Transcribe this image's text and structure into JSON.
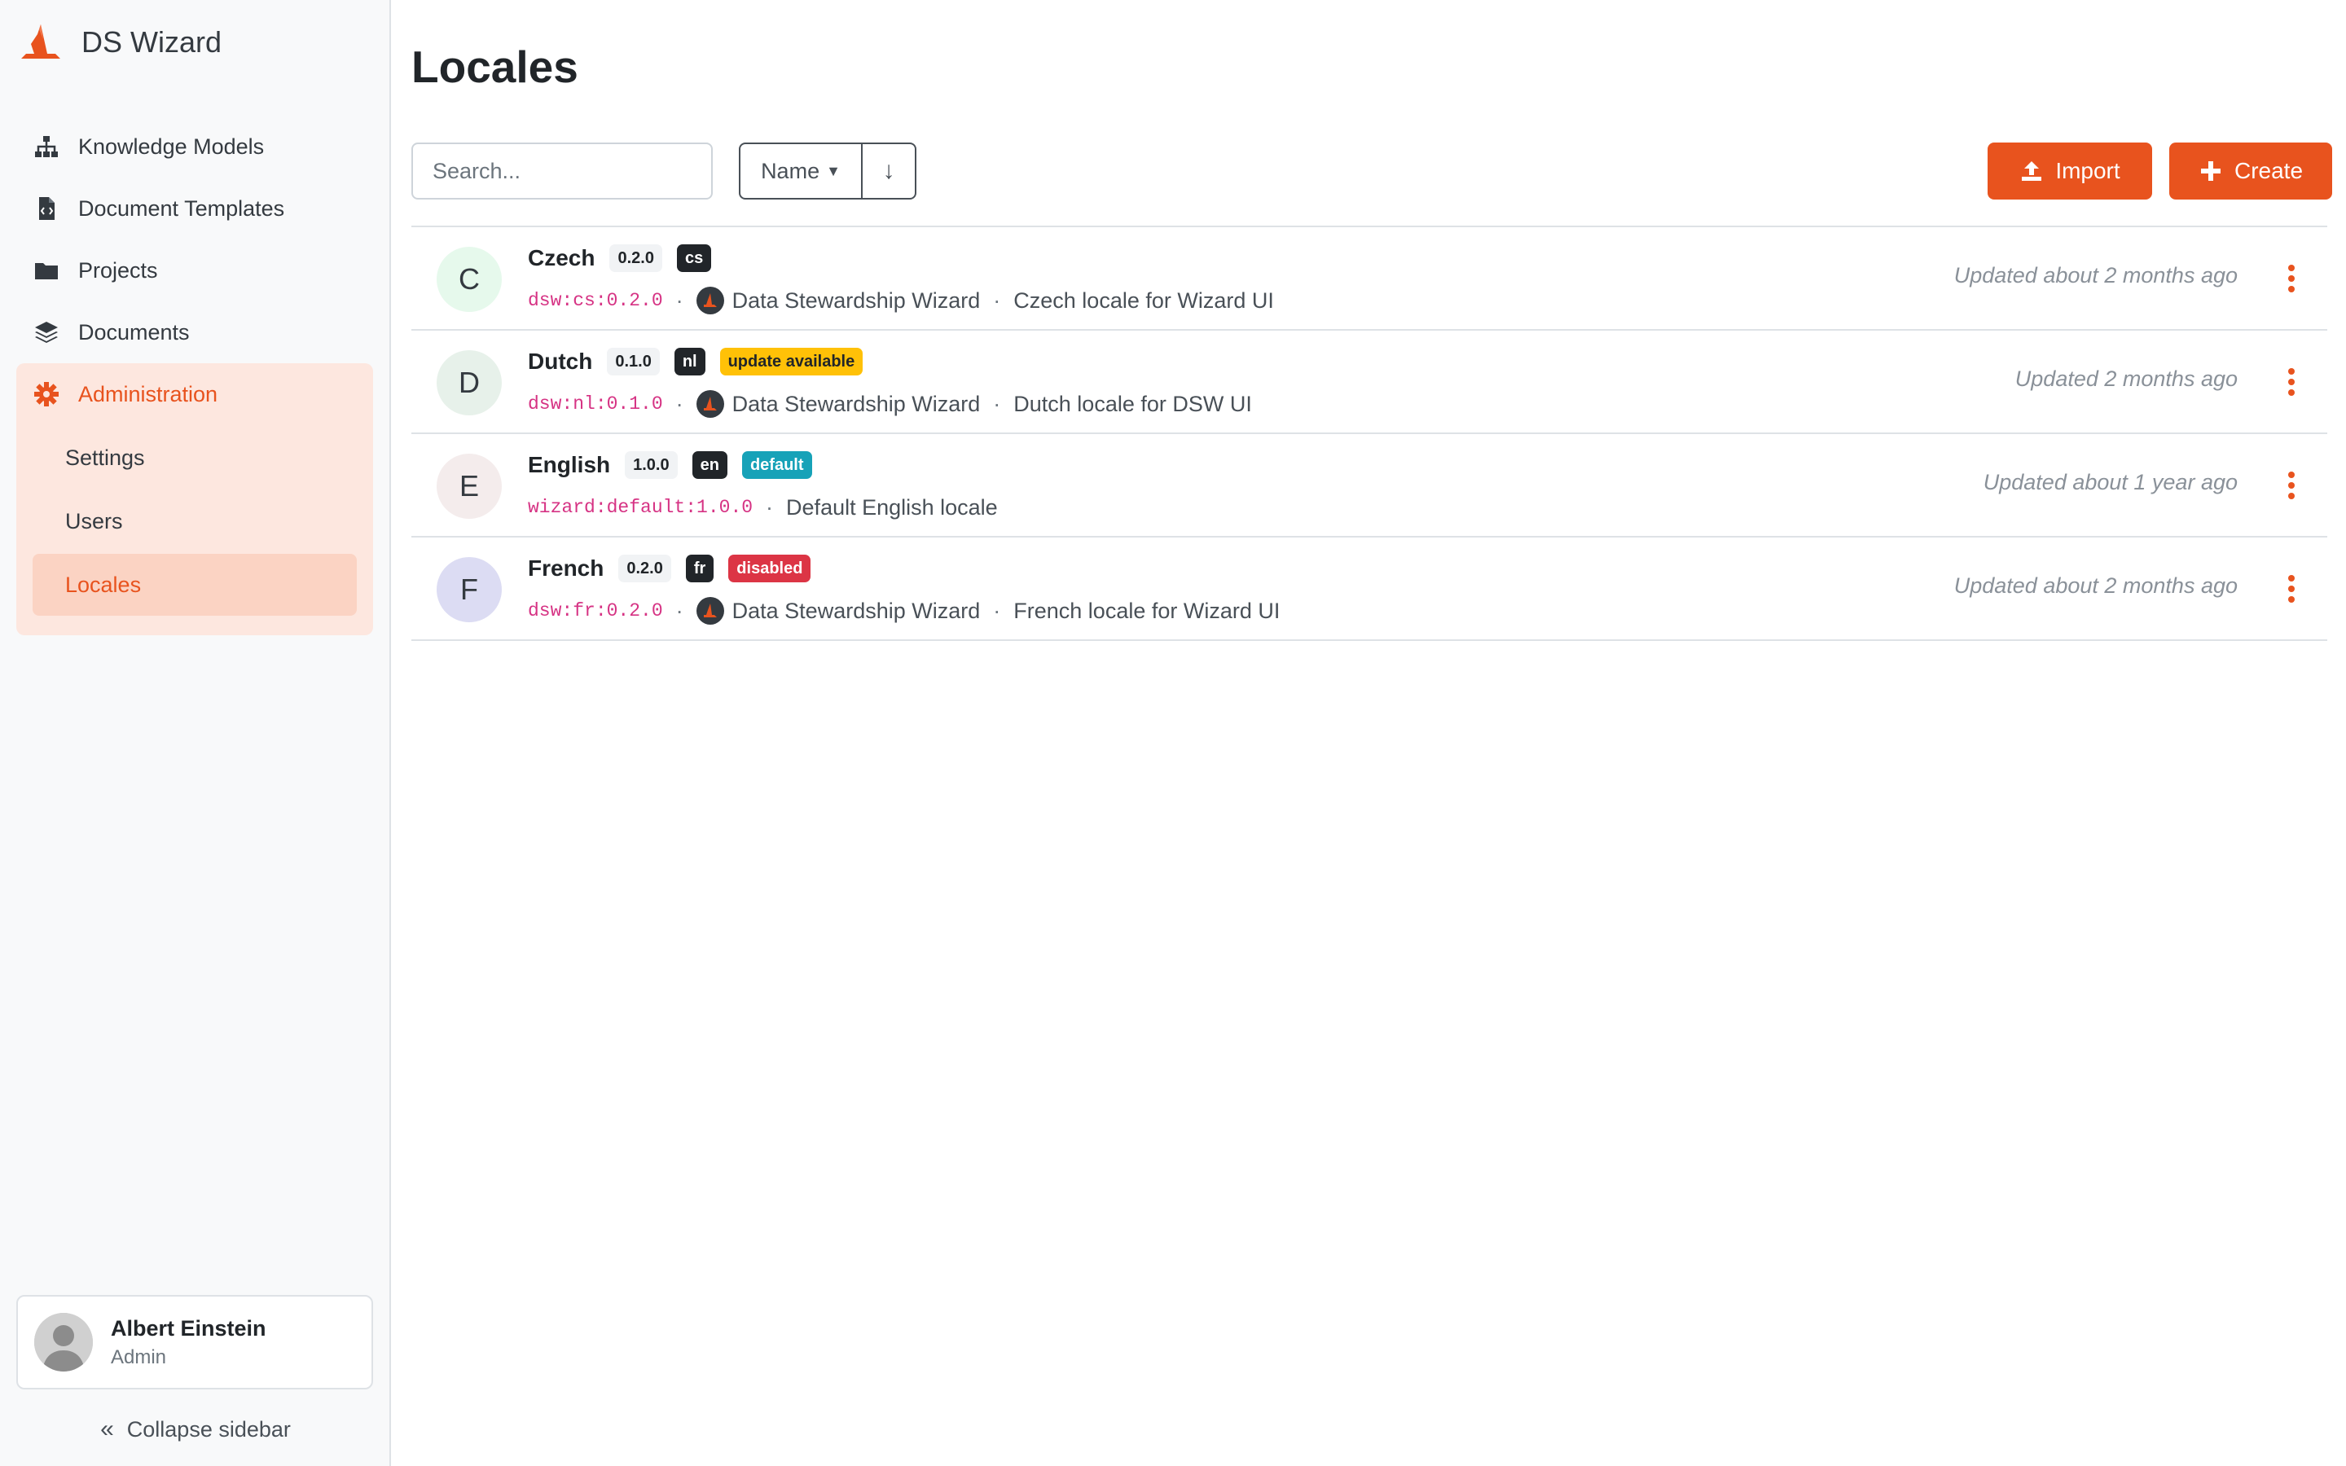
{
  "app": {
    "name": "DS Wizard"
  },
  "colors": {
    "accent": "#e8531e",
    "sidebar_bg": "#f8f9fa",
    "admin_bg": "#fde7df",
    "active_bg": "#fbd3c3"
  },
  "sidebar": {
    "items": [
      {
        "label": "Knowledge Models",
        "icon": "sitemap-icon"
      },
      {
        "label": "Document Templates",
        "icon": "file-code-icon"
      },
      {
        "label": "Projects",
        "icon": "folder-icon"
      },
      {
        "label": "Documents",
        "icon": "layers-icon"
      }
    ],
    "admin": {
      "label": "Administration",
      "icon": "gear-icon",
      "subitems": [
        {
          "label": "Settings"
        },
        {
          "label": "Users"
        },
        {
          "label": "Locales",
          "active": true
        }
      ]
    },
    "profile": {
      "name": "Albert Einstein",
      "role": "Admin"
    },
    "collapse_label": "Collapse sidebar"
  },
  "main": {
    "title": "Locales",
    "search": {
      "placeholder": "Search..."
    },
    "sort": {
      "label": "Name"
    },
    "import_label": "Import",
    "create_label": "Create",
    "locales": [
      {
        "letter": "C",
        "letter_bg": "#e6f9ec",
        "name": "Czech",
        "version": "0.2.0",
        "code": "cs",
        "extra_badge": null,
        "id": "dsw:cs:0.2.0",
        "org": "Data Stewardship Wizard",
        "description": "Czech locale for Wizard UI",
        "updated": "Updated about 2 months ago"
      },
      {
        "letter": "D",
        "letter_bg": "#e7f1ea",
        "name": "Dutch",
        "version": "0.1.0",
        "code": "nl",
        "extra_badge": {
          "label": "update available",
          "kind": "update"
        },
        "id": "dsw:nl:0.1.0",
        "org": "Data Stewardship Wizard",
        "description": "Dutch locale for DSW UI",
        "updated": "Updated 2 months ago"
      },
      {
        "letter": "E",
        "letter_bg": "#f4ecec",
        "name": "English",
        "version": "1.0.0",
        "code": "en",
        "extra_badge": {
          "label": "default",
          "kind": "default"
        },
        "id": "wizard:default:1.0.0",
        "org": null,
        "description": "Default English locale",
        "updated": "Updated about 1 year ago"
      },
      {
        "letter": "F",
        "letter_bg": "#dcdcf3",
        "name": "French",
        "version": "0.2.0",
        "code": "fr",
        "extra_badge": {
          "label": "disabled",
          "kind": "disabled"
        },
        "id": "dsw:fr:0.2.0",
        "org": "Data Stewardship Wizard",
        "description": "French locale for Wizard UI",
        "updated": "Updated about 2 months ago"
      }
    ]
  }
}
